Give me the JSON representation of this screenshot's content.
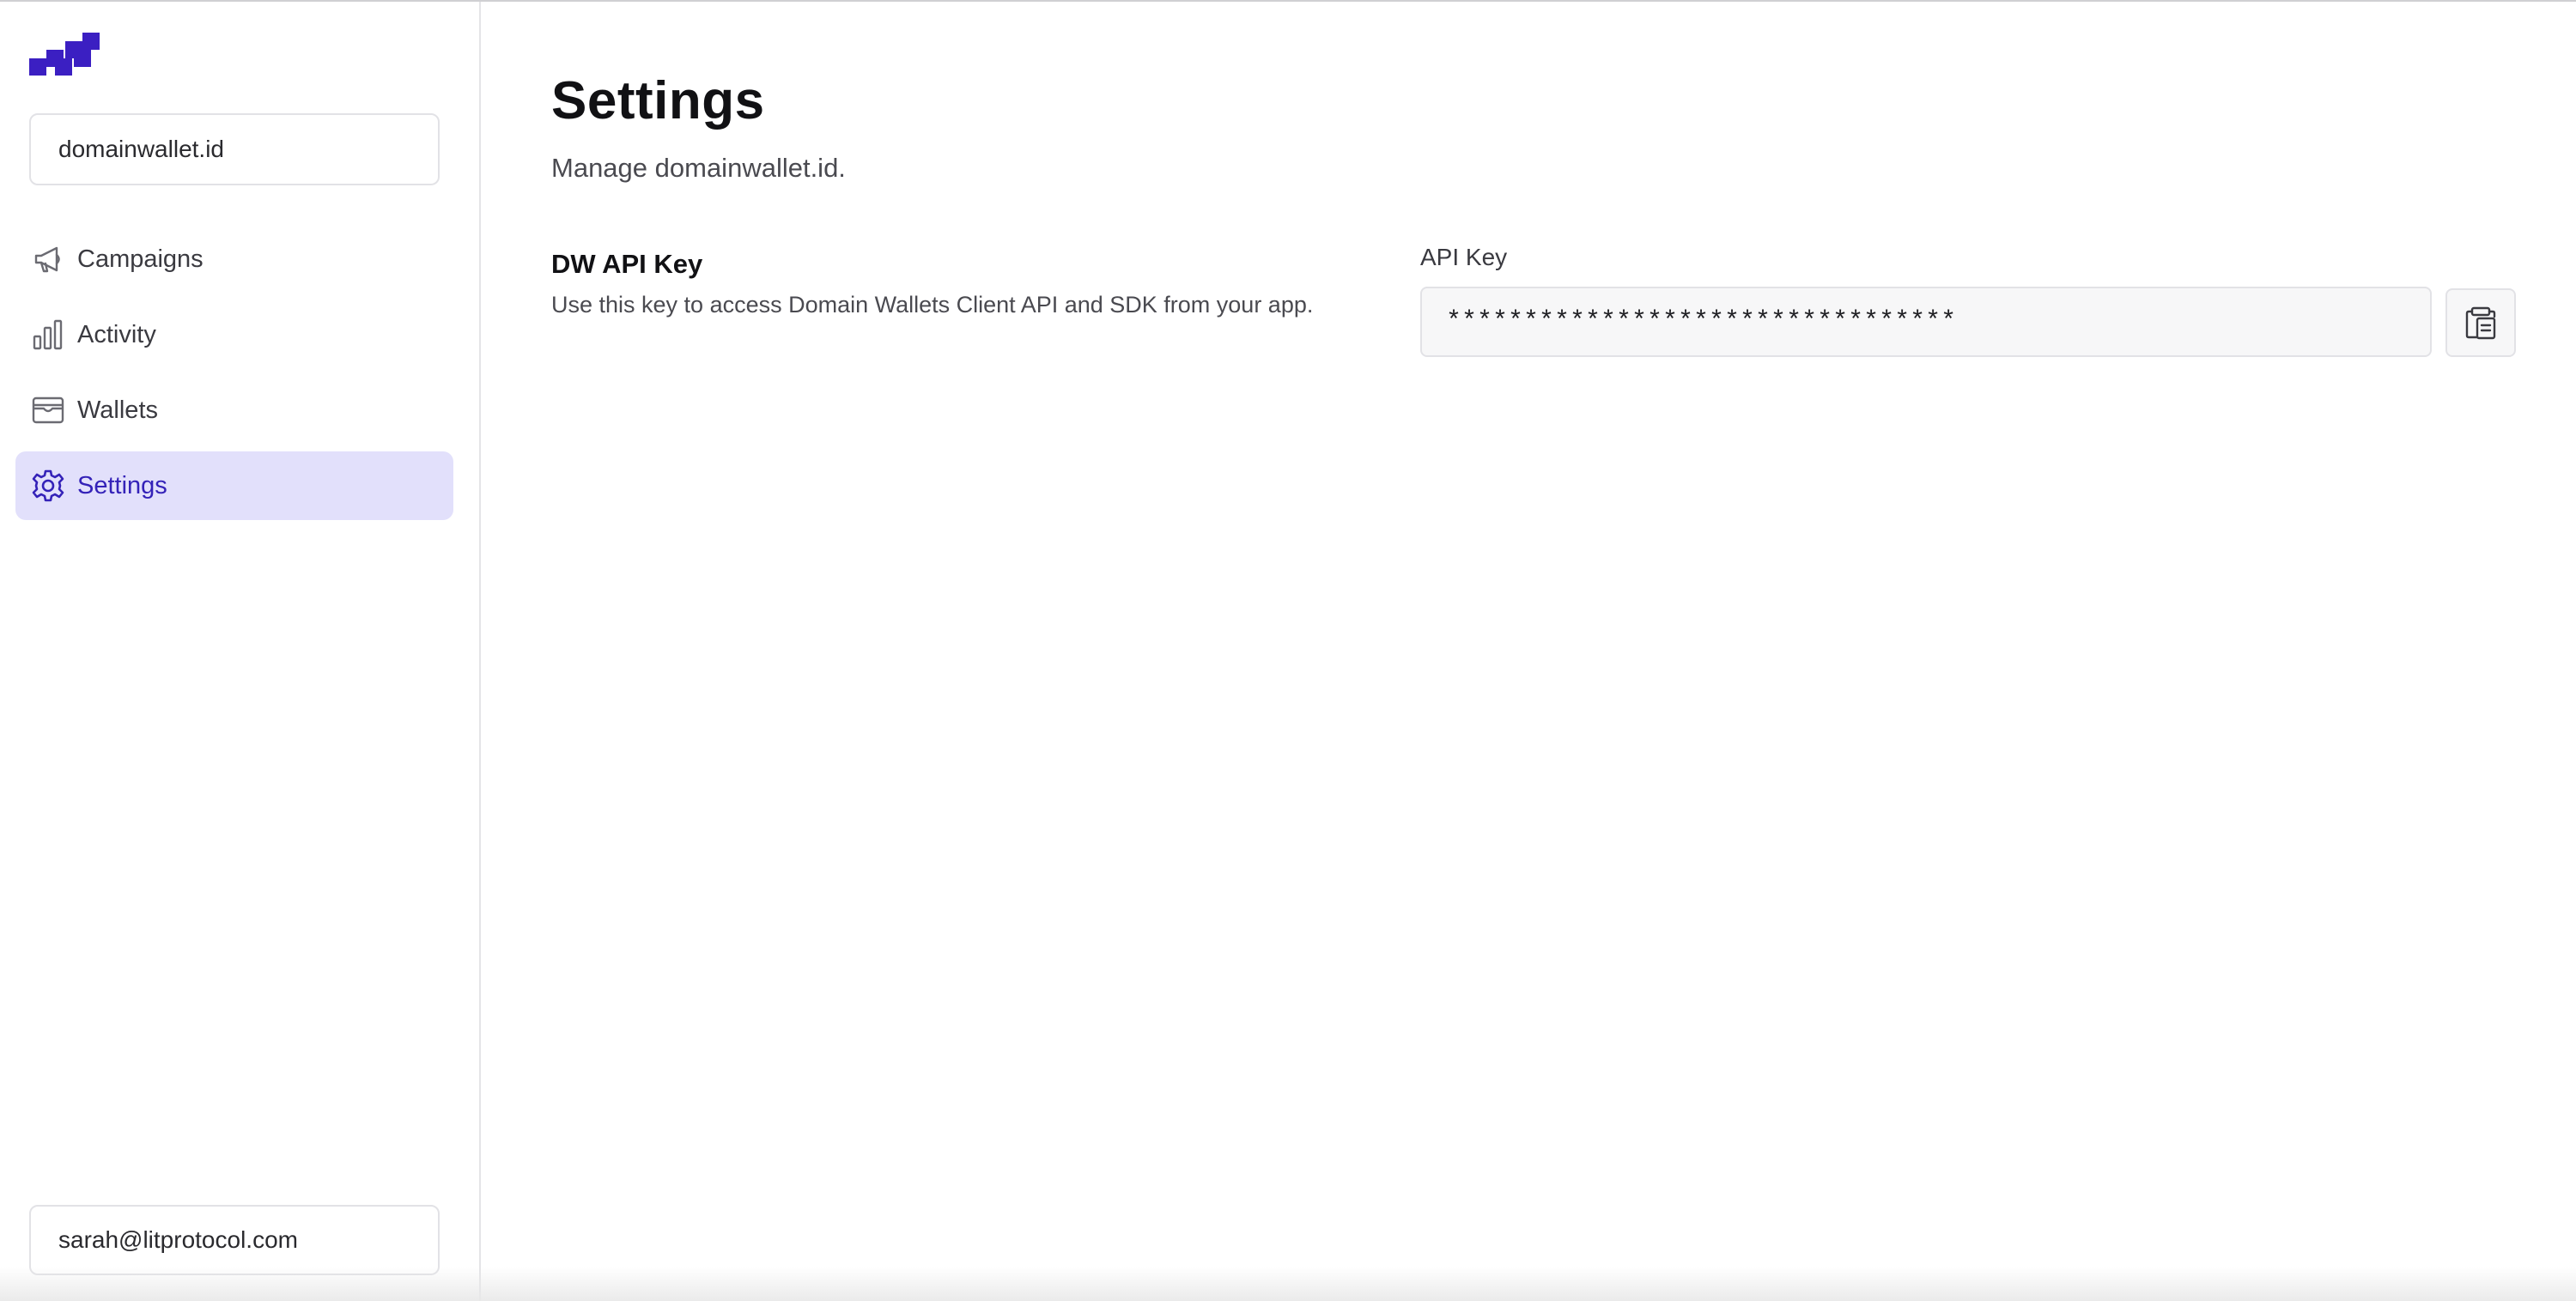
{
  "sidebar": {
    "org": "domainwallet.id",
    "items": [
      {
        "label": "Campaigns",
        "icon": "megaphone-icon"
      },
      {
        "label": "Activity",
        "icon": "bar-chart-icon"
      },
      {
        "label": "Wallets",
        "icon": "wallet-icon"
      },
      {
        "label": "Settings",
        "icon": "gear-icon",
        "active": true
      }
    ],
    "user_email": "sarah@litprotocol.com"
  },
  "main": {
    "title": "Settings",
    "subtitle": "Manage domainwallet.id.",
    "section": {
      "title": "DW API Key",
      "description": "Use this key to access Domain Wallets Client API and SDK from your app.",
      "field_label": "API Key",
      "field_value": "*********************************",
      "copy_icon": "clipboard-icon"
    }
  },
  "colors": {
    "brand": "#3b1fc2",
    "active_bg": "#e2e0fb",
    "active_text": "#3422b8"
  }
}
